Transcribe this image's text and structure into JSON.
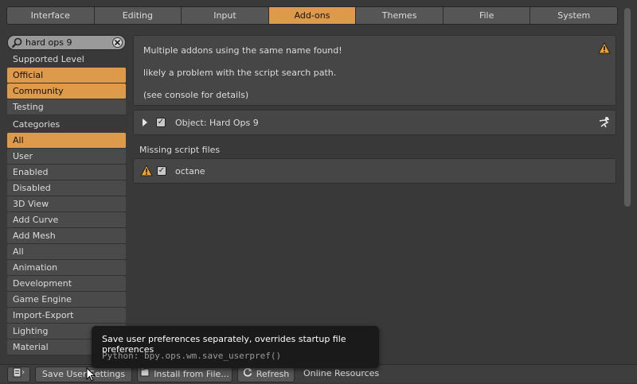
{
  "tabs": [
    {
      "label": "Interface"
    },
    {
      "label": "Editing"
    },
    {
      "label": "Input"
    },
    {
      "label": "Add-ons",
      "active": true
    },
    {
      "label": "Themes"
    },
    {
      "label": "File"
    },
    {
      "label": "System"
    }
  ],
  "search": {
    "value": "hard ops 9",
    "icon": "search-icon",
    "clear_icon": "close-icon"
  },
  "sidebar": {
    "supported_label": "Supported Level",
    "supported_items": [
      {
        "label": "Official",
        "selected": true
      },
      {
        "label": "Community",
        "selected": true
      },
      {
        "label": "Testing",
        "selected": false
      }
    ],
    "categories_label": "Categories",
    "category_items": [
      {
        "label": "All",
        "selected": true
      },
      {
        "label": "User"
      },
      {
        "label": "Enabled"
      },
      {
        "label": "Disabled"
      },
      {
        "label": "3D View"
      },
      {
        "label": "Add Curve"
      },
      {
        "label": "Add Mesh"
      },
      {
        "label": "All"
      },
      {
        "label": "Animation"
      },
      {
        "label": "Development"
      },
      {
        "label": "Game Engine"
      },
      {
        "label": "Import-Export"
      },
      {
        "label": "Lighting"
      },
      {
        "label": "Material"
      }
    ]
  },
  "warning": {
    "line1": "Multiple addons using the same name found!",
    "line2": "likely a problem with the script search path.",
    "line3": "(see console for details)",
    "icon": "warning-icon"
  },
  "addon": {
    "label": "Object: Hard Ops 9",
    "enabled": true,
    "icon": "user-addon-icon"
  },
  "missing": {
    "label": "Missing script files",
    "file": "octane",
    "icon": "warning-icon"
  },
  "bottombar": {
    "save_label": "Save User Settings",
    "install_label": "Install from File...",
    "refresh_label": "Refresh",
    "online_label": "Online Resources"
  },
  "tooltip": {
    "title": "Save user preferences separately, overrides startup file preferences",
    "python": "Python: bpy.ops.wm.save_userpref()"
  },
  "colors": {
    "accent": "#dd9a4b",
    "background": "#393939",
    "panel": "#464646"
  }
}
